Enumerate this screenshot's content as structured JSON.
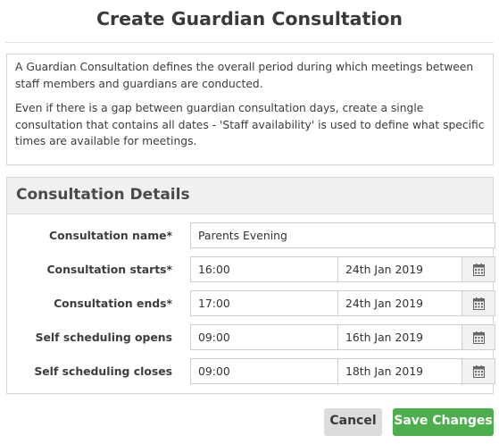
{
  "dialog": {
    "title": "Create Guardian Consultation"
  },
  "intro": {
    "paragraph1": "A Guardian Consultation defines the overall period during which meetings between staff members and guardians are conducted.",
    "paragraph2": "Even if there is a gap between guardian consultation days, create a single consultation that contains all dates - 'Staff availability' is used to define what specific times are available for meetings."
  },
  "details": {
    "header": "Consultation Details",
    "name": {
      "label": "Consultation name*",
      "value": "Parents Evening"
    },
    "starts": {
      "label": "Consultation starts*",
      "time": "16:00",
      "date": "24th Jan 2019"
    },
    "ends": {
      "label": "Consultation ends*",
      "time": "17:00",
      "date": "24th Jan 2019"
    },
    "self_opens": {
      "label": "Self scheduling opens",
      "time": "09:00",
      "date": "16th Jan 2019"
    },
    "self_closes": {
      "label": "Self scheduling closes",
      "time": "09:00",
      "date": "18th Jan 2019"
    },
    "calendar_icon": "calendar-icon"
  },
  "actions": {
    "cancel_label": "Cancel",
    "save_label": "Save Changes"
  },
  "colors": {
    "primary": "#4cae4c",
    "secondary": "#dcdcdc"
  }
}
